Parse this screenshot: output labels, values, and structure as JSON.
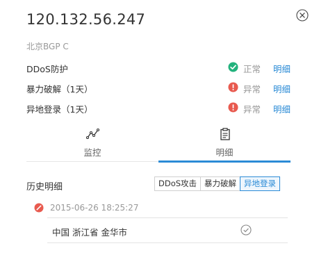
{
  "header": {
    "ip": "120.132.56.247",
    "region": "北京BGP C"
  },
  "status_rows": [
    {
      "label": "DDoS防护",
      "state": "正常",
      "state_type": "ok",
      "link": "明细"
    },
    {
      "label": "暴力破解（1天）",
      "state": "异常",
      "state_type": "error",
      "link": "明细"
    },
    {
      "label": "异地登录（1天）",
      "state": "异常",
      "state_type": "error",
      "link": "明细"
    }
  ],
  "tabs": [
    {
      "label": "监控",
      "icon": "line-chart-icon",
      "active": false
    },
    {
      "label": "明细",
      "icon": "clipboard-icon",
      "active": true
    }
  ],
  "history": {
    "title": "历史明细",
    "filters": [
      {
        "label": "DDoS攻击",
        "active": false
      },
      {
        "label": "暴力破解",
        "active": false
      },
      {
        "label": "异地登录",
        "active": true
      }
    ],
    "records": [
      {
        "time": "2015-06-26 18:25:27",
        "location": "中国 浙江省 金华市",
        "status_icon": "check-circle-icon"
      }
    ]
  },
  "colors": {
    "accent": "#2b8bd6",
    "ok": "#23b27d",
    "error": "#e85a4f",
    "muted": "#999999"
  }
}
